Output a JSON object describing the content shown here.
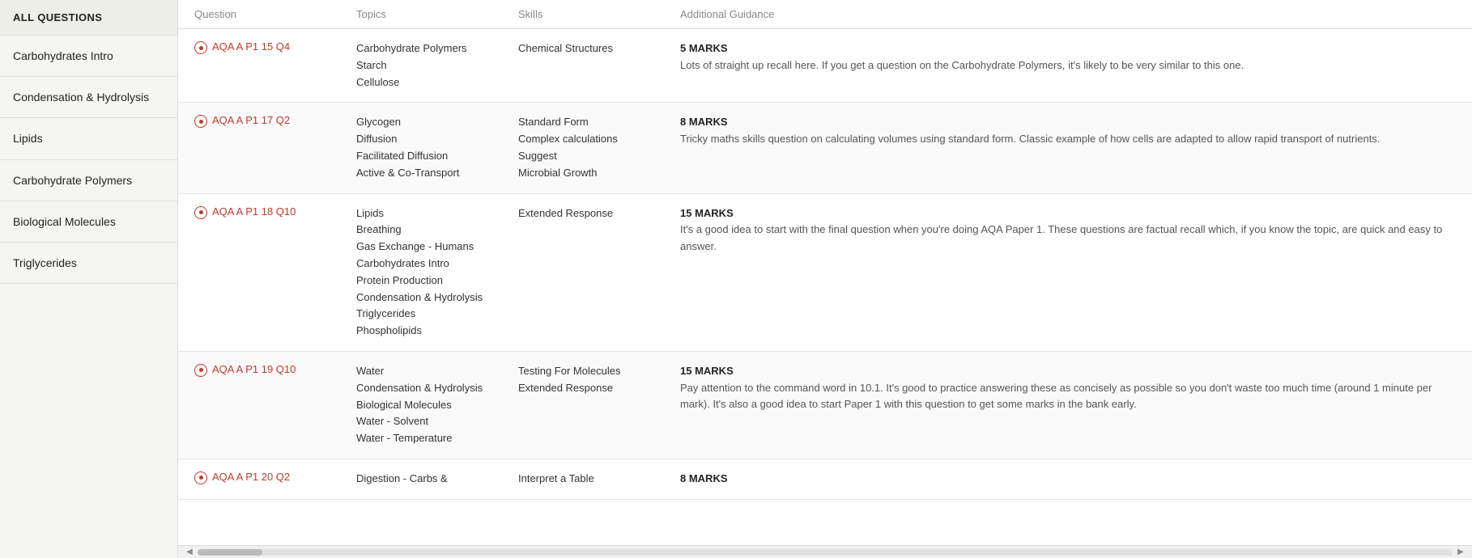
{
  "sidebar": {
    "all_questions_label": "ALL QUESTIONS",
    "items": [
      {
        "id": "carbohydrates-intro",
        "label": "Carbohydrates Intro"
      },
      {
        "id": "condensation-hydrolysis",
        "label": "Condensation & Hydrolysis"
      },
      {
        "id": "lipids",
        "label": "Lipids"
      },
      {
        "id": "carbohydrate-polymers",
        "label": "Carbohydrate Polymers"
      },
      {
        "id": "biological-molecules",
        "label": "Biological Molecules"
      },
      {
        "id": "triglycerides",
        "label": "Triglycerides"
      }
    ]
  },
  "table": {
    "headers": [
      "Question",
      "Topics",
      "Skills",
      "Additional Guidance"
    ],
    "rows": [
      {
        "question": "AQA A P1 15 Q4",
        "topics": [
          "Carbohydrate Polymers",
          "Starch",
          "Cellulose"
        ],
        "skills": [
          "Chemical Structures"
        ],
        "marks": "5 MARKS",
        "guidance": "Lots of straight up recall here. If you get a question on the Carbohydrate Polymers, it's likely to be very similar to this one."
      },
      {
        "question": "AQA A P1 17 Q2",
        "topics": [
          "Glycogen",
          "Diffusion",
          "Facilitated Diffusion",
          "Active & Co-Transport"
        ],
        "skills": [
          "Standard Form",
          "Complex calculations",
          "Suggest",
          "Microbial Growth"
        ],
        "marks": "8 MARKS",
        "guidance": "Tricky maths skills question on calculating volumes using standard form. Classic example of how cells are adapted to allow rapid transport of nutrients."
      },
      {
        "question": "AQA A P1 18 Q10",
        "topics": [
          "Lipids",
          "Breathing",
          "Gas Exchange - Humans",
          "Carbohydrates Intro",
          "Protein Production",
          "Condensation & Hydrolysis",
          "Triglycerides",
          "Phospholipids"
        ],
        "skills": [
          "Extended Response"
        ],
        "marks": "15 MARKS",
        "guidance": "It's a good idea to start with the final question when you're doing AQA Paper 1. These questions are factual recall which, if you know the topic, are quick and easy to answer."
      },
      {
        "question": "AQA A P1 19 Q10",
        "topics": [
          "Water",
          "Condensation & Hydrolysis",
          "Biological Molecules",
          "Water - Solvent",
          "Water - Temperature"
        ],
        "skills": [
          "Testing For Molecules",
          "Extended Response"
        ],
        "marks": "15 MARKS",
        "guidance": "Pay attention to the command word in 10.1. It's good to practice answering these as concisely as possible so you don't waste too much time (around 1 minute per mark). It's also a good idea to start Paper 1 with this question to get some marks in the bank early."
      },
      {
        "question": "AQA A P1 20 Q2",
        "topics": [
          "Digestion - Carbs &"
        ],
        "skills": [
          "Interpret a Table"
        ],
        "marks": "8 MARKS",
        "guidance": ""
      }
    ]
  },
  "colors": {
    "question_link": "#c0392b",
    "marks_bold": "#222",
    "header_text": "#888"
  }
}
